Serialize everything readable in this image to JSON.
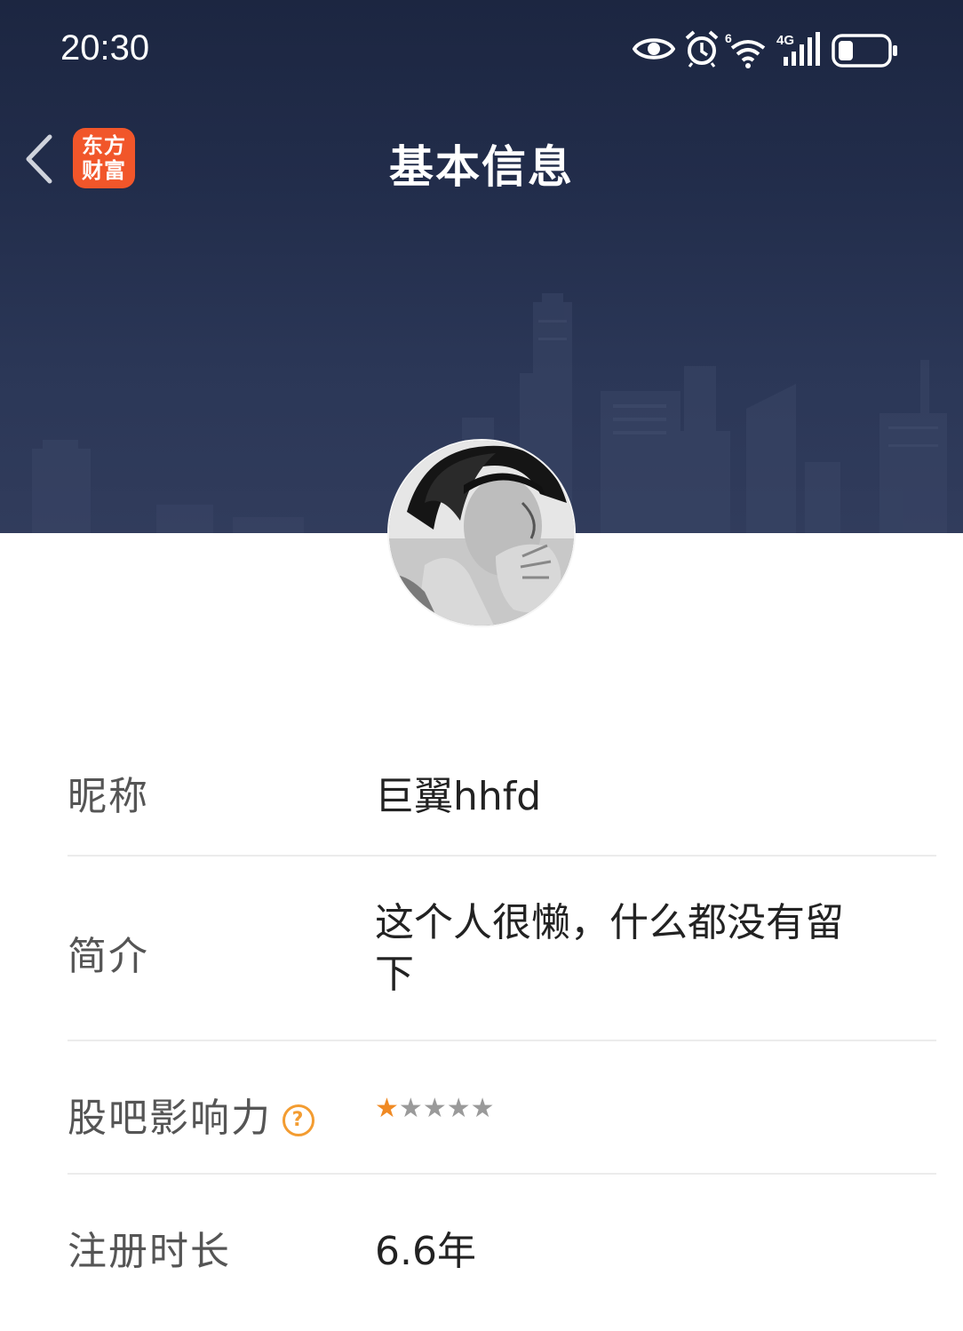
{
  "status_bar": {
    "time": "20:30",
    "icons": [
      "eye-icon",
      "alarm-icon",
      "wifi-icon",
      "signal-4g-icon",
      "battery-icon"
    ],
    "wifi_label": "6",
    "signal_label": "4G"
  },
  "header": {
    "title": "基本信息",
    "logo_line1": "东方",
    "logo_line2": "财富",
    "logo_color": "#f1562a",
    "background_color": "#232d4b"
  },
  "profile": {
    "rows": [
      {
        "label": "昵称",
        "value": "巨翼hhfd"
      },
      {
        "label": "简介",
        "value_line1": "这个人很懒，什么都没有留",
        "value_line2": "下"
      },
      {
        "label": "股吧影响力",
        "help": "?",
        "rating": 1,
        "rating_max": 5
      },
      {
        "label": "注册时长",
        "value": "6.6年"
      }
    ]
  },
  "colors": {
    "accent": "#f08a24",
    "label": "#555555",
    "value": "#222222",
    "divider": "#ececec"
  }
}
